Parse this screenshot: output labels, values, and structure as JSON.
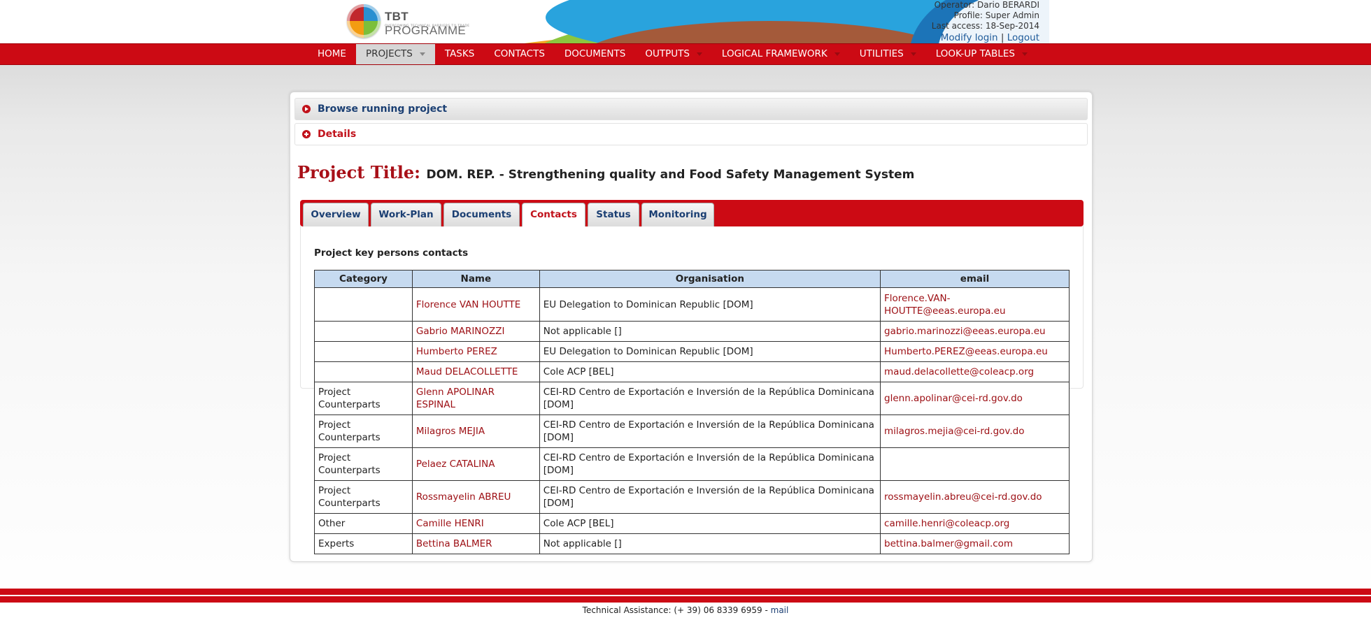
{
  "header": {
    "logo_title_bold": "TBT",
    "logo_title_rest": " PROGRAMME",
    "logo_subtitle": "OVERCOMING TECHNICAL BARRIERS TO TRADE",
    "operator": "Operator: Dario BERARDI",
    "profile": "Profile: Super Admin",
    "last_access": "Last access: 18-Sep-2014",
    "modify_login": "Modify login",
    "separator": " | ",
    "logout": "Logout"
  },
  "nav": {
    "items": [
      {
        "label": "HOME",
        "dropdown": false
      },
      {
        "label": "PROJECTS",
        "dropdown": true,
        "active": true
      },
      {
        "label": "TASKS",
        "dropdown": false
      },
      {
        "label": "CONTACTS",
        "dropdown": false
      },
      {
        "label": "DOCUMENTS",
        "dropdown": false
      },
      {
        "label": "OUTPUTS",
        "dropdown": true
      },
      {
        "label": "LOGICAL FRAMEWORK",
        "dropdown": true
      },
      {
        "label": "UTILITIES",
        "dropdown": true
      },
      {
        "label": "LOOK-UP TABLES",
        "dropdown": true
      }
    ]
  },
  "accordion": {
    "browse_label": "Browse running project",
    "details_label": "Details"
  },
  "project": {
    "title_label": "Project Title:",
    "title_value": "DOM. REP. - Strengthening quality and Food Safety Management System"
  },
  "tabs": [
    {
      "label": "Overview"
    },
    {
      "label": "Work-Plan"
    },
    {
      "label": "Documents"
    },
    {
      "label": "Contacts",
      "active": true
    },
    {
      "label": "Status"
    },
    {
      "label": "Monitoring"
    }
  ],
  "contacts": {
    "section_title": "Project key persons contacts",
    "headers": {
      "category": "Category",
      "name": "Name",
      "organisation": "Organisation",
      "email": "email"
    },
    "rows": [
      {
        "category": "",
        "name": "Florence VAN HOUTTE",
        "organisation": "EU Delegation to Dominican Republic [DOM]",
        "email": "Florence.VAN-HOUTTE@eeas.europa.eu"
      },
      {
        "category": "",
        "name": "Gabrio MARINOZZI",
        "organisation": "Not applicable []",
        "email": "gabrio.marinozzi@eeas.europa.eu"
      },
      {
        "category": "",
        "name": "Humberto PEREZ",
        "organisation": "EU Delegation to Dominican Republic [DOM]",
        "email": "Humberto.PEREZ@eeas.europa.eu"
      },
      {
        "category": "",
        "name": "Maud DELACOLLETTE",
        "organisation": "Cole ACP [BEL]",
        "email": "maud.delacollette@coleacp.org"
      },
      {
        "category": "Project Counterparts",
        "name": "Glenn APOLINAR ESPINAL",
        "organisation": "CEI-RD Centro de Exportación e Inversión de la República Dominicana [DOM]",
        "email": "glenn.apolinar@cei-rd.gov.do"
      },
      {
        "category": "Project Counterparts",
        "name": "Milagros MEJIA",
        "organisation": "CEI-RD Centro de Exportación e Inversión de la República Dominicana [DOM]",
        "email": "milagros.mejia@cei-rd.gov.do"
      },
      {
        "category": "Project Counterparts",
        "name": "Pelaez CATALINA",
        "organisation": "CEI-RD Centro de Exportación e Inversión de la República Dominicana [DOM]",
        "email": ""
      },
      {
        "category": "Project Counterparts",
        "name": "Rossmayelin ABREU",
        "organisation": "CEI-RD Centro de Exportación e Inversión de la República Dominicana [DOM]",
        "email": "rossmayelin.abreu@cei-rd.gov.do"
      },
      {
        "category": "Other",
        "name": "Camille HENRI",
        "organisation": "Cole ACP [BEL]",
        "email": "camille.henri@coleacp.org"
      },
      {
        "category": "Experts",
        "name": "Bettina BALMER",
        "organisation": "Not applicable []",
        "email": "bettina.balmer@gmail.com"
      }
    ]
  },
  "footer": {
    "text": "Technical Assistance: (+ 39) 06 8339 6959 - ",
    "mail_link": "mail"
  }
}
